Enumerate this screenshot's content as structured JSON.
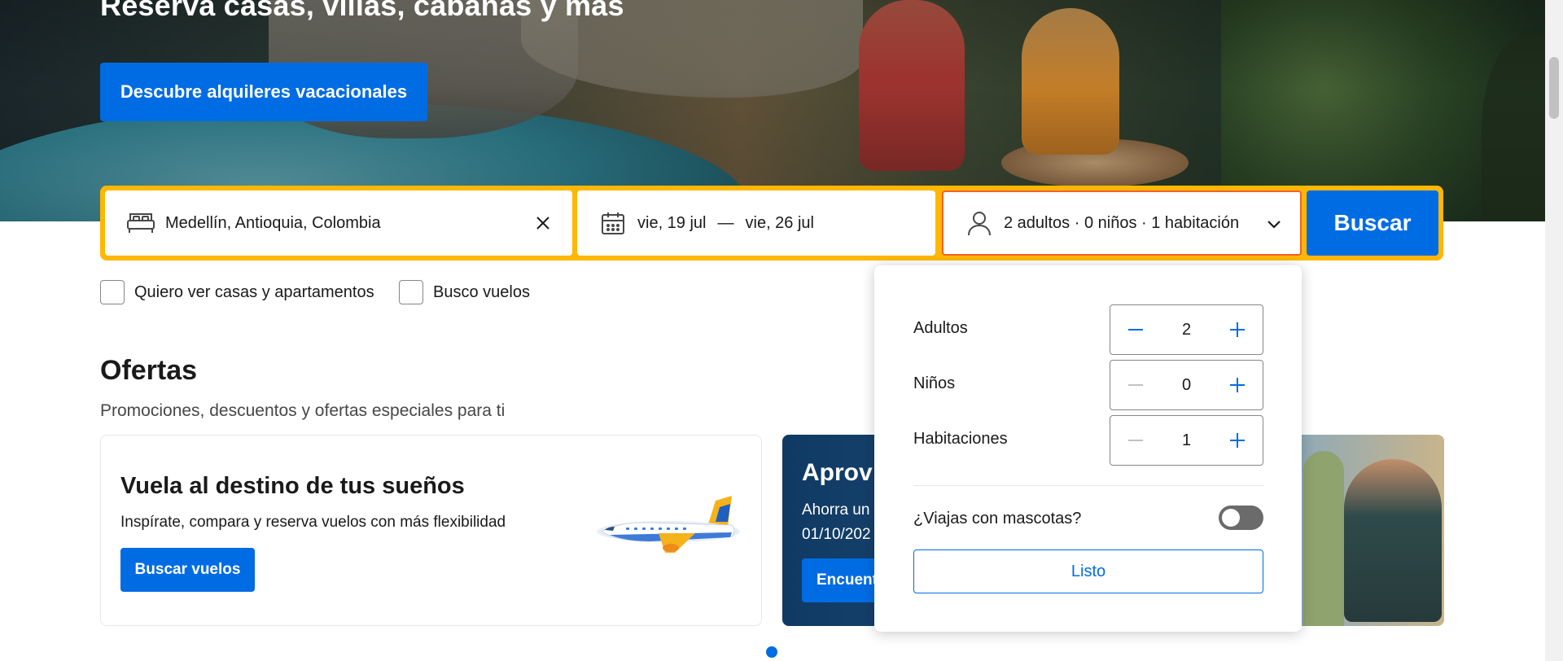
{
  "hero": {
    "title": "Reserva casas, villas, cabañas y más",
    "cta_label": "Descubre alquileres vacacionales"
  },
  "search": {
    "destination": "Medellín, Antioquia, Colombia",
    "checkin": "vie, 19 jul",
    "separator": "—",
    "checkout": "vie, 26 jul",
    "guests_summary": "2 adultos · 0 niños · 1 habitación",
    "submit_label": "Buscar"
  },
  "options": {
    "homes_label": "Quiero ver casas y apartamentos",
    "flights_label": "Busco vuelos"
  },
  "offers": {
    "title": "Ofertas",
    "subtitle": "Promociones, descuentos y ofertas especiales para ti",
    "cards": [
      {
        "title": "Vuela al destino de tus sueños",
        "description": "Inspírate, compara y reserva vuelos con más flexibilidad",
        "button": "Buscar vuelos"
      },
      {
        "title": "Aprov",
        "description_line1": "Ahorra un",
        "description_line2": "01/10/202",
        "button": "Encuent"
      }
    ]
  },
  "guests_dropdown": {
    "adults_label": "Adultos",
    "adults_value": "2",
    "children_label": "Niños",
    "children_value": "0",
    "rooms_label": "Habitaciones",
    "rooms_value": "1",
    "pets_label": "¿Viajas con mascotas?",
    "pets_enabled": false,
    "done_label": "Listo"
  },
  "colors": {
    "brand_blue": "#006ce4",
    "search_border": "#ffb700",
    "focus_border": "#f2602b"
  }
}
